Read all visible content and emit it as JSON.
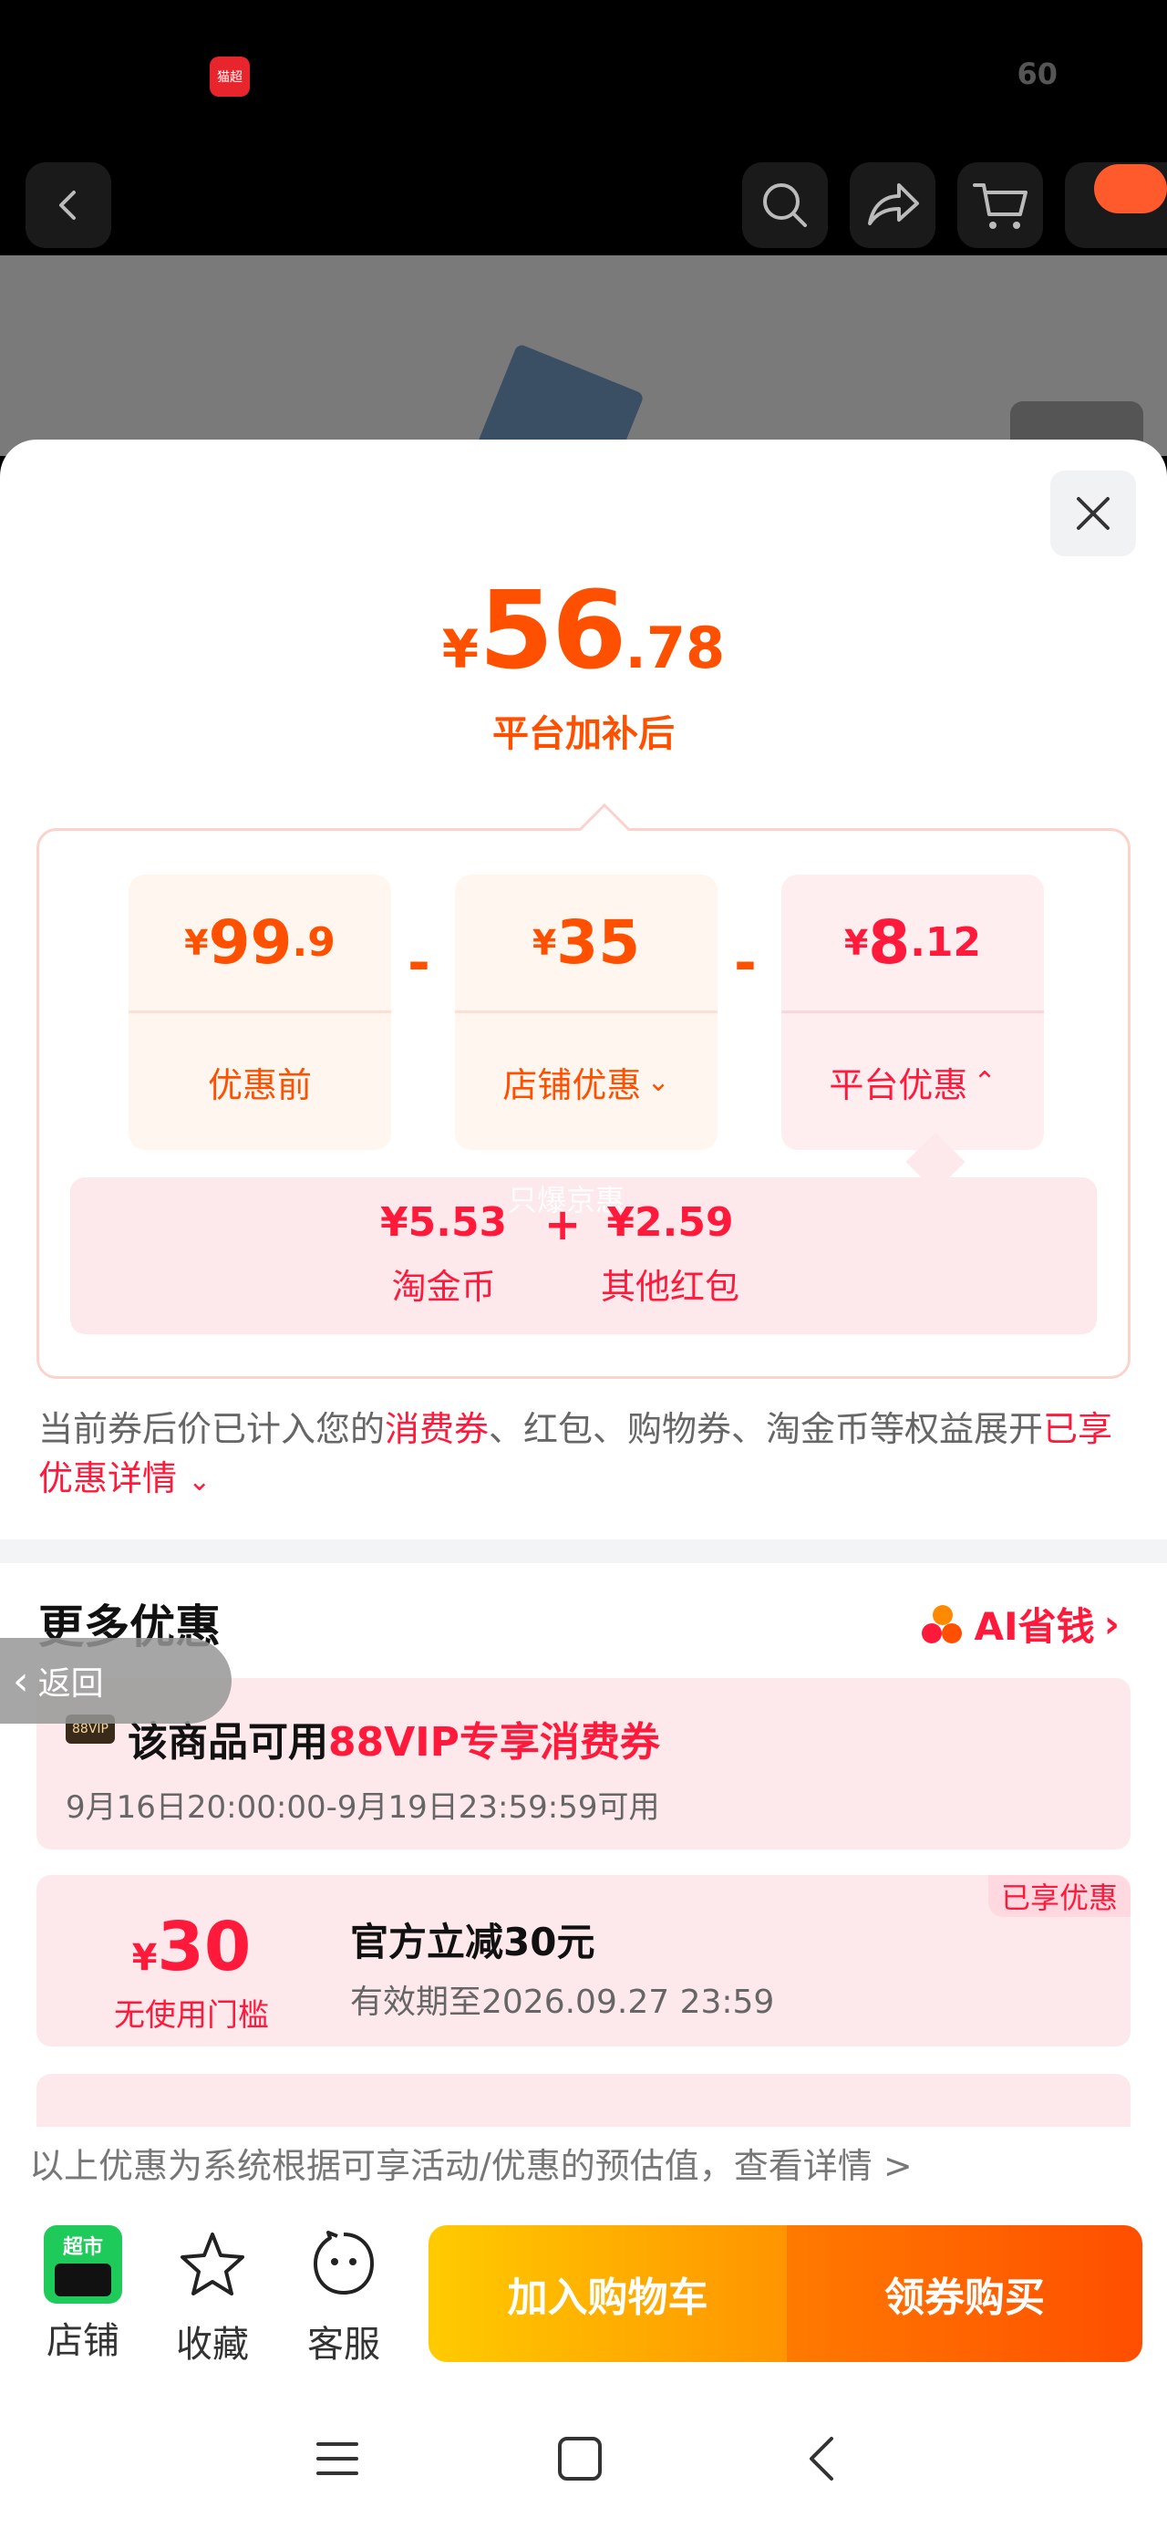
{
  "status_bar": {
    "badge_text": "猫超",
    "signal_text": "60"
  },
  "price": {
    "currency": "¥",
    "integer": "56",
    "decimal": ".78",
    "subtitle": "平台加补后"
  },
  "breakdown": {
    "before": {
      "currency": "¥",
      "integer": "99",
      "decimal": ".9",
      "label": "优惠前"
    },
    "store": {
      "currency": "¥",
      "integer": "35",
      "decimal": "",
      "label": "店铺优惠",
      "chevron": "⌄"
    },
    "platform": {
      "currency": "¥",
      "integer": "8",
      "decimal": ".12",
      "label": "平台优惠",
      "chevron": "⌃"
    },
    "operator": "-",
    "platform_detail": {
      "coin_value": "¥5.53",
      "coin_label": "淘金币",
      "plus": "+",
      "redpack_value": "¥2.59",
      "redpack_label": "其他红包",
      "watermark": "只爆京惠"
    }
  },
  "note": {
    "prefix": "当前券后价已计入您的",
    "highlight1": "消费券",
    "middle": "、红包、购物券、淘金币等权益展开",
    "highlight2": "已享优惠详情",
    "chevron": "⌄"
  },
  "more": {
    "title": "更多优惠",
    "ai_label": "AI省钱",
    "ai_chevron": "›",
    "vip_coupon": {
      "badge": "88VIP",
      "title_prefix": "该商品可用",
      "title_highlight": "88VIP专享消费券",
      "validity": "9月16日20:00:00-9月19日23:59:59可用"
    },
    "direct_coupon": {
      "currency": "¥",
      "amount": "30",
      "condition": "无使用门槛",
      "title": "官方立减30元",
      "validity": "有效期至2026.09.27 23:59",
      "badge": "已享优惠"
    }
  },
  "disclaimer": "以上优惠为系统根据可享活动/优惠的预估值，查看详情 >",
  "back_pill": {
    "arrow": "‹",
    "label": "返回"
  },
  "bottom_bar": {
    "store_badge": "超市",
    "store": "店铺",
    "favorite": "收藏",
    "service": "客服",
    "add_to_cart": "加入购物车",
    "buy": "领券购买"
  },
  "colors": {
    "accent_orange": "#ff5000",
    "accent_red": "#ff1a3c"
  }
}
